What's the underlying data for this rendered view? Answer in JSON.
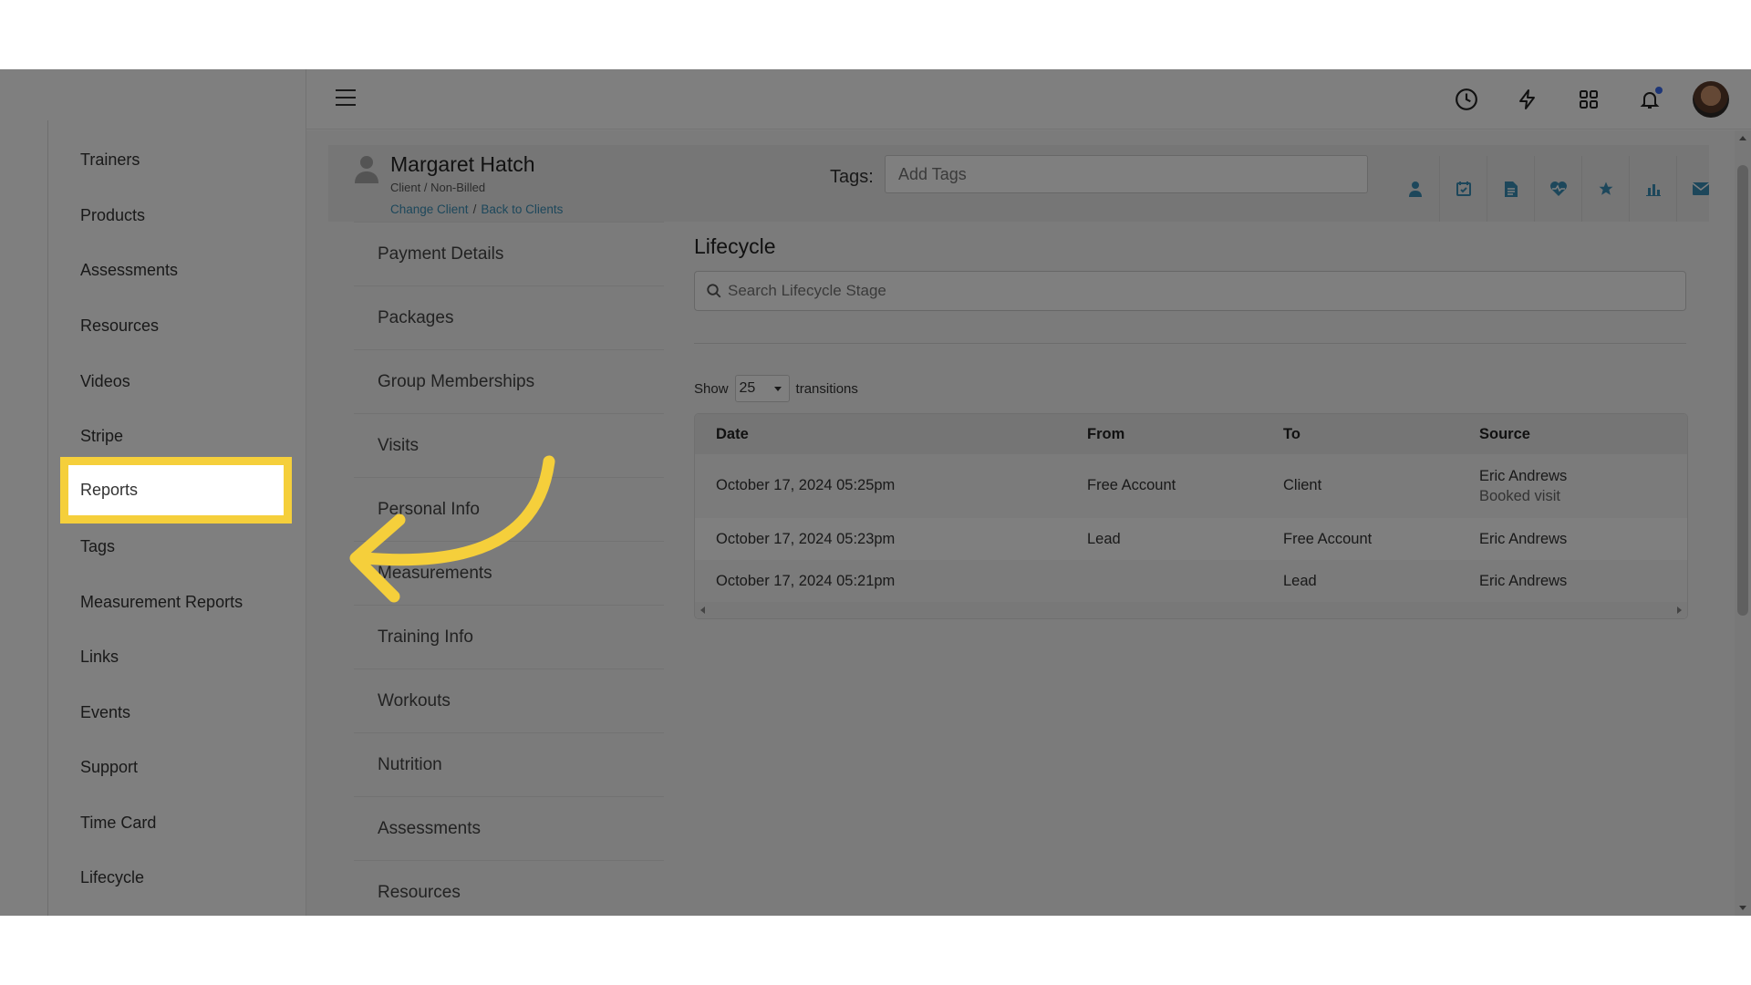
{
  "sidebar": {
    "items": [
      {
        "label": "Trainers"
      },
      {
        "label": "Products"
      },
      {
        "label": "Assessments"
      },
      {
        "label": "Resources"
      },
      {
        "label": "Videos"
      },
      {
        "label": "Stripe"
      },
      {
        "label": "Reports",
        "highlighted": true
      },
      {
        "label": "Tags"
      },
      {
        "label": "Measurement Reports"
      },
      {
        "label": "Links"
      },
      {
        "label": "Events"
      },
      {
        "label": "Support"
      },
      {
        "label": "Time Card"
      },
      {
        "label": "Lifecycle"
      }
    ]
  },
  "topbar": {
    "icons": [
      "menu-icon",
      "history-clock-icon",
      "lightning-icon",
      "apps-grid-icon",
      "bell-icon",
      "user-avatar"
    ],
    "notification_dot_color": "#3b6cf0"
  },
  "client": {
    "name": "Margaret Hatch",
    "type": "Client / Non-Billed",
    "change_link": "Change Client",
    "separator": "/",
    "back_link": "Back to Clients",
    "tags_label": "Tags:",
    "tags_placeholder": "Add Tags",
    "action_icons": [
      "profile-icon",
      "calendar-icon",
      "document-icon",
      "heart-rate-icon",
      "star-icon",
      "bar-chart-icon",
      "email-icon"
    ],
    "accent_color": "#3a8fb6"
  },
  "submenu": {
    "items": [
      {
        "label": "Payment Details"
      },
      {
        "label": "Packages"
      },
      {
        "label": "Group Memberships"
      },
      {
        "label": "Visits"
      },
      {
        "label": "Personal Info"
      },
      {
        "label": "Measurements"
      },
      {
        "label": "Training Info"
      },
      {
        "label": "Workouts"
      },
      {
        "label": "Nutrition"
      },
      {
        "label": "Assessments"
      },
      {
        "label": "Resources"
      }
    ]
  },
  "lifecycle": {
    "title": "Lifecycle",
    "search_placeholder": "Search Lifecycle Stage",
    "show_label": "Show",
    "show_value": "25",
    "show_suffix": "transitions",
    "columns": [
      "Date",
      "From",
      "To",
      "Source"
    ],
    "rows": [
      {
        "date": "October 17, 2024 05:25pm",
        "from": "Free Account",
        "to": "Client",
        "source": "Eric Andrews",
        "source_detail": "Booked visit"
      },
      {
        "date": "October 17, 2024 05:23pm",
        "from": "Lead",
        "to": "Free Account",
        "source": "Eric Andrews",
        "source_detail": ""
      },
      {
        "date": "October 17, 2024 05:21pm",
        "from": "",
        "to": "Lead",
        "source": "Eric Andrews",
        "source_detail": ""
      }
    ]
  },
  "annotation": {
    "highlight_label": "Reports",
    "highlight_color": "#f5cf3b"
  }
}
